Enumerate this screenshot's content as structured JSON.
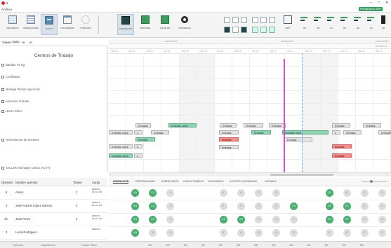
{
  "app": {
    "title": "8",
    "notification": "Planificación 35%",
    "min": "–",
    "max": "□",
    "close": "✕"
  },
  "menu": {
    "file": "Archivo"
  },
  "ribbon": {
    "groups": [
      {
        "label": "RECURSOS"
      },
      {
        "label": "OPERACIONES"
      },
      {
        "label": "GANTT"
      },
      {
        "label": "CALENDARIO"
      },
      {
        "label": "PUBLICAR"
      },
      {
        "label": "ASIGNACIÓN"
      },
      {
        "label": "ENTRADA"
      },
      {
        "label": "VÍA DE MS"
      },
      {
        "label": "PROGRESO"
      }
    ],
    "right_buttons": [
      {
        "label": "EDIT"
      },
      {
        "label": "AA"
      },
      {
        "label": "AB"
      },
      {
        "label": "AC"
      },
      {
        "label": "AD"
      },
      {
        "label": "AE"
      },
      {
        "label": "AF"
      },
      {
        "label": "AG"
      }
    ]
  },
  "view_tabs": [
    {
      "label": "TODOS"
    },
    {
      "label": "DATA"
    },
    {
      "label": "HH"
    },
    {
      "label": "UP"
    }
  ],
  "left_panel": {
    "header": "Centros de Trabajo",
    "resources": [
      {
        "name": "Bandas 70 Kg"
      },
      {
        "name": "Cocilinado"
      },
      {
        "name": "Montaje Piezas Inyección"
      },
      {
        "name": "Ascensor Grande"
      },
      {
        "name": "Horno Chico"
      },
      {
        "name": "Horno/sector de envases"
      },
      {
        "name": "TALLER: Montajes Varios (ALVT)"
      }
    ]
  },
  "timeline": {
    "weeks": [
      {
        "label": "Semana 01"
      },
      {
        "label": "Semana 02"
      },
      {
        "label": "Enero 2022"
      },
      {
        "label": "Semana 3"
      }
    ],
    "days": [
      "Mar 01",
      "Mie 02",
      "Jue 03",
      "Vie 04",
      "Sab 05",
      "Dom 06",
      "Lun 07",
      "Mar 08",
      "Mie 09",
      "Jue 10",
      "Vie 11",
      "Sab 12",
      "Dom 13",
      "Lun 14",
      "Mar 15",
      "Mie 16"
    ],
    "tasks": [
      {
        "label": "Embalar",
        "color": "grey"
      },
      {
        "label": "Embalar rollos",
        "color": "green"
      },
      {
        "label": "Embalar",
        "color": "grey"
      },
      {
        "label": "Embalar",
        "color": "grey"
      },
      {
        "label": "Embalar",
        "color": "grey"
      },
      {
        "label": "Embalar",
        "color": "grey"
      },
      {
        "label": "Embalar",
        "color": "grey"
      },
      {
        "label": "Embalar rollos",
        "color": "grey"
      },
      {
        "label": "2",
        "color": "grey"
      },
      {
        "label": "Embalar",
        "color": "grey"
      },
      {
        "label": "Embalar",
        "color": "grey"
      },
      {
        "label": "Embalar",
        "color": "green"
      },
      {
        "label": "Embalar rollos",
        "color": "green"
      },
      {
        "label": "2",
        "color": "grey"
      },
      {
        "label": "Embalar",
        "color": "grey"
      },
      {
        "label": "Embalar",
        "color": "grey"
      },
      {
        "label": "Embalar",
        "color": "green"
      },
      {
        "label": "Embalar",
        "color": "red"
      },
      {
        "label": "Embalar rollos",
        "color": "grey"
      },
      {
        "label": "Embalar",
        "color": "grey"
      },
      {
        "label": "Embalar rollos",
        "color": "grey"
      },
      {
        "label": "2",
        "color": "grey"
      },
      {
        "label": "Embalar",
        "color": "grey"
      },
      {
        "label": "Embalar",
        "color": "red"
      },
      {
        "label": "Embalar rollos",
        "color": "green"
      },
      {
        "label": "2",
        "color": "grey"
      },
      {
        "label": "Embalar",
        "color": "red"
      }
    ]
  },
  "operators": {
    "columns": {
      "op": "Operario",
      "name": "Nombre operario",
      "tasks": "Tareas",
      "load": "Carga"
    },
    "rows": [
      {
        "op": "9",
        "name": "Arturo",
        "tasks": "2",
        "load": "2000 hrs. 10 hrs. 0%"
      },
      {
        "op": "2",
        "name": "José Antonio López Gimeno",
        "tasks": "3",
        "load": "2000 hrs. 15 hrs. 1%"
      },
      {
        "op": "10",
        "name": "Juan Perez",
        "tasks": "2",
        "load": "2000 hrs. 10 hrs. 0%"
      },
      {
        "op": "3",
        "name": "Lucía Rodríguez",
        "tasks": "",
        "load": "2000 hrs."
      }
    ]
  },
  "assignment_tabs": [
    {
      "label": "ASIGNACIÓN"
    },
    {
      "label": "DISPONIBILIDAD"
    },
    {
      "label": "SOBRECARGA"
    },
    {
      "label": "CARGA TRABAJO"
    },
    {
      "label": "CALENDARIO"
    },
    {
      "label": "AJUSTES CALENDARIO"
    },
    {
      "label": "VARIABLE"
    }
  ],
  "assignment_cells": [
    [
      "",
      "g",
      "g",
      "l",
      "",
      "",
      "l",
      "l",
      "l",
      "l",
      "",
      "",
      "g",
      "l",
      "l",
      "l"
    ],
    [
      "",
      "g",
      "g",
      "l",
      "",
      "",
      "l",
      "l",
      "l",
      "l",
      "g",
      "",
      "g",
      "g",
      "l",
      "l"
    ],
    [
      "",
      "g",
      "g",
      "l",
      "",
      "",
      "g",
      "g",
      "l",
      "l",
      "l",
      "",
      "g",
      "g",
      "l",
      "l"
    ],
    [
      "",
      "g",
      "l",
      "l",
      "",
      "",
      "l",
      "l",
      "l",
      "l",
      "l",
      "",
      "l",
      "l",
      "l",
      "l"
    ]
  ],
  "cell_labels": {
    "g": "0.5",
    "l": "0"
  },
  "statusbar": {
    "left": "Operarios",
    "middle": "Asignaciones",
    "right": "Limpiar Filtros",
    "totals": [
      "40h",
      "40h",
      "40h",
      "40h",
      "40h",
      "40h",
      "40h",
      "40h",
      "40h",
      "40h",
      "40h",
      "40h",
      "40h"
    ]
  },
  "colors": {
    "accent": "#3c9b5d",
    "today_line": "#e244e0",
    "green_task": "#8fd4b0",
    "red_task": "#f08d8d"
  }
}
